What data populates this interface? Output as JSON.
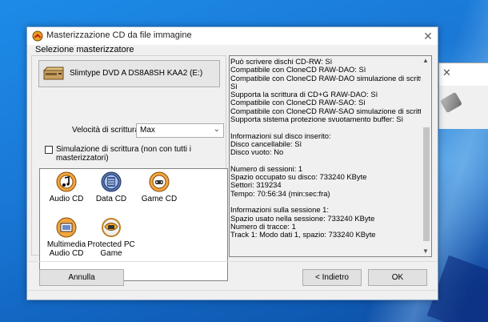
{
  "window": {
    "title": "Masterizzazione CD da file immagine",
    "close_glyph": "✕",
    "app_icon": "nero-burn-icon"
  },
  "recorder": {
    "group_label": "Selezione masterizzatore",
    "drive_label": "Slimtype DVD A  DS8A8SH KAA2 (E:)",
    "speed_label": "Velocità di scrittura:",
    "speed_value": "Max",
    "simulation_label": "Simulazione di scrittura (non con tutti i masterizzatori)",
    "simulation_checked": false
  },
  "project_types": [
    {
      "label": "Audio CD",
      "icon": "audio-cd-icon"
    },
    {
      "label": "Data CD",
      "icon": "data-cd-icon"
    },
    {
      "label": "Game CD",
      "icon": "game-cd-icon"
    },
    {
      "label": "Multimedia Audio CD",
      "line1": "Multimedia",
      "line2": "Audio CD",
      "icon": "multimedia-icon"
    },
    {
      "label": "Protected PC Game",
      "line1": "Protected PC",
      "line2": "Game",
      "icon": "protected-game-icon"
    }
  ],
  "info": {
    "lines": [
      "Può scrivere dischi CD-RW: Sì",
      "Compatibile con CloneCD RAW-DAO: Sì",
      "Compatibile con CloneCD RAW-DAO simulazione di scrittura:",
      "Sì",
      "Supporta la scrittura di CD+G RAW-DAO: Sì",
      "Compatibile con CloneCD RAW-SAO: Sì",
      "Compatibile con CloneCD RAW-SAO simulazione di scrittura: Sì",
      "Supporta sistema protezione svuotamento buffer: Sì",
      "",
      "Informazioni sul disco inserito:",
      "Disco cancellabile: Sì",
      "Disco vuoto: No",
      "",
      "Numero di sessioni: 1",
      "Spazio occupato su disco: 733240 KByte",
      "Settori: 319234",
      "Tempo: 70:56:34 (min:sec:fra)",
      "",
      "Informazioni sulla sessione 1:",
      "Spazio usato nella sessione: 733240 KByte",
      "Numero di tracce: 1",
      "Track 1: Modo dati 1, spazio: 733240 KByte"
    ]
  },
  "buttons": {
    "cancel": "Annulla",
    "back": "< Indietro",
    "ok": "OK"
  },
  "background_window": {
    "close_glyph": "✕"
  }
}
